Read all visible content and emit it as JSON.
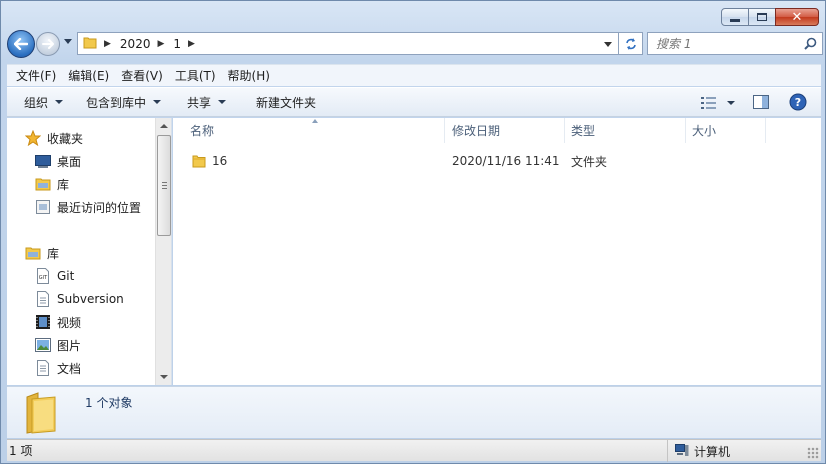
{
  "window": {
    "caption_buttons": [
      "minimize",
      "maximize",
      "close"
    ]
  },
  "navigation": {
    "breadcrumb": [
      "2020",
      "1"
    ],
    "search_placeholder": "搜索 1"
  },
  "menubar": {
    "items": [
      "文件(F)",
      "编辑(E)",
      "查看(V)",
      "工具(T)",
      "帮助(H)"
    ]
  },
  "toolbar": {
    "organize": "组织",
    "include_in_library": "包含到库中",
    "share": "共享",
    "new_folder": "新建文件夹"
  },
  "sidebar": {
    "favorites": {
      "label": "收藏夹",
      "items": [
        "桌面",
        "库",
        "最近访问的位置"
      ]
    },
    "libraries": {
      "label": "库",
      "items": [
        "Git",
        "Subversion",
        "视频",
        "图片",
        "文档"
      ]
    }
  },
  "file_list": {
    "columns": [
      "名称",
      "修改日期",
      "类型",
      "大小"
    ],
    "rows": [
      {
        "name": "16",
        "modified": "2020/11/16 11:41",
        "type": "文件夹",
        "size": ""
      }
    ]
  },
  "details_pane": {
    "summary": "1 个对象"
  },
  "status_bar": {
    "item_count": "1 项",
    "location": "计算机"
  },
  "colors": {
    "frame": "#c2d5ec",
    "folder_yellow": "#f2c94c",
    "accent_blue": "#2b6fc0"
  }
}
